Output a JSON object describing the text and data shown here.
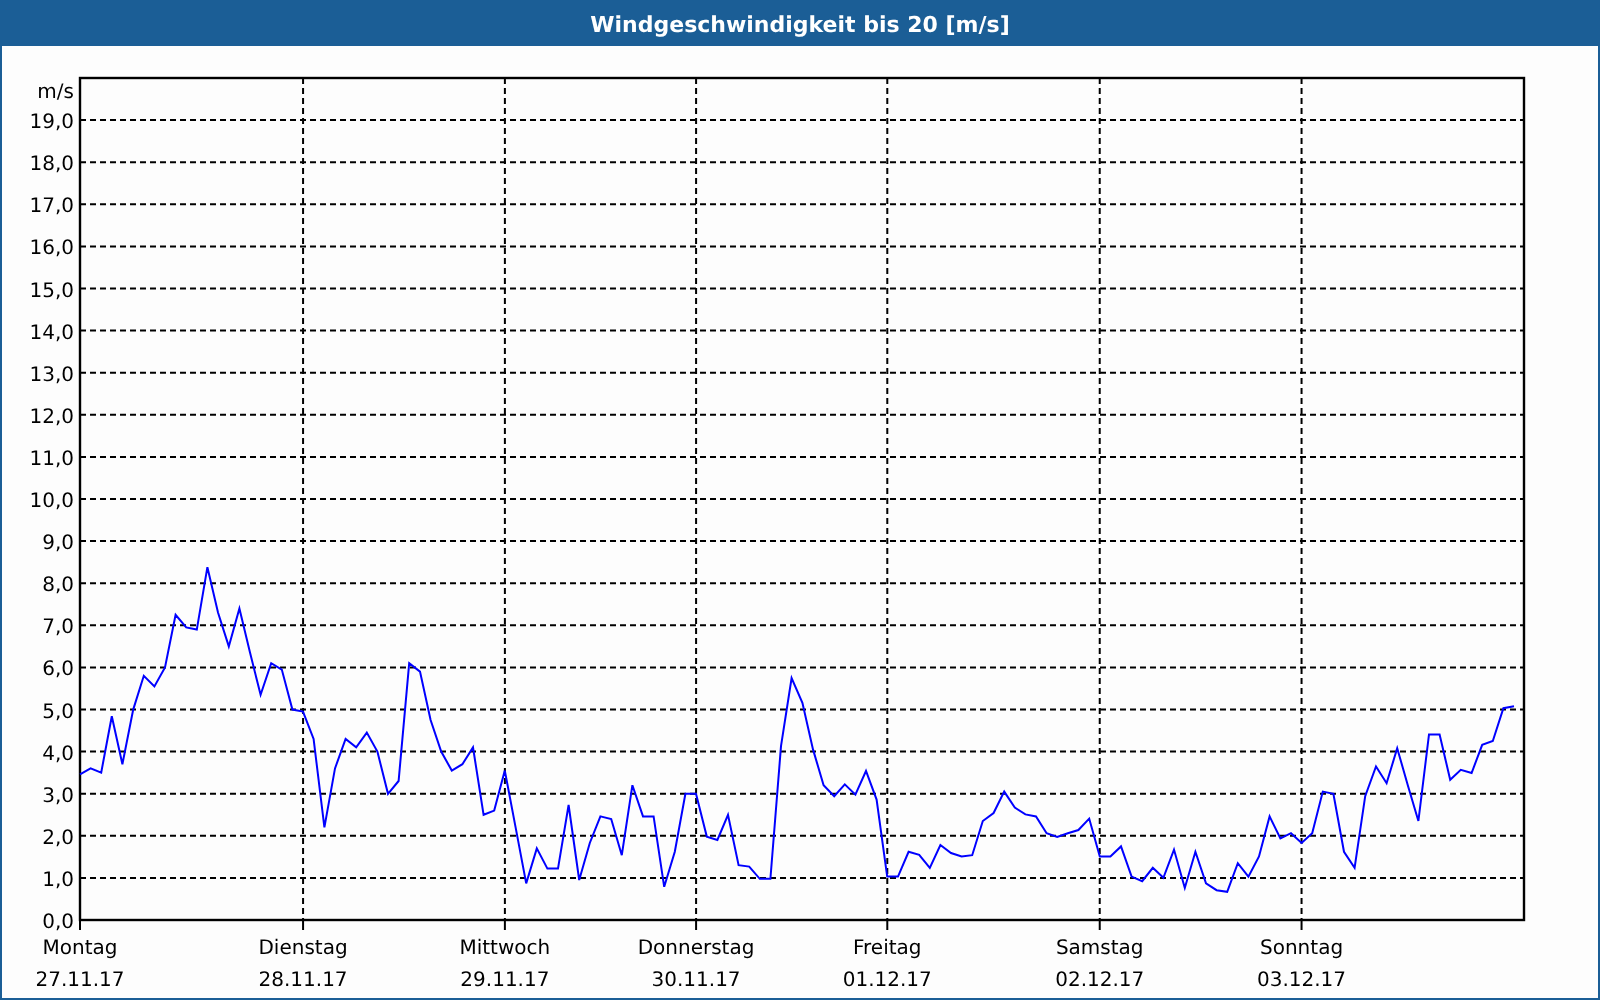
{
  "window": {
    "title": "Windgeschwindigkeit bis 20 [m/s]"
  },
  "chart_data": {
    "type": "line",
    "ylabel": "m/s",
    "grid": true,
    "ylim": [
      0,
      20
    ],
    "yticks": [
      {
        "value": 0,
        "label": "0,0"
      },
      {
        "value": 1,
        "label": "1,0"
      },
      {
        "value": 2,
        "label": "2,0"
      },
      {
        "value": 3,
        "label": "3,0"
      },
      {
        "value": 4,
        "label": "4,0"
      },
      {
        "value": 5,
        "label": "5,0"
      },
      {
        "value": 6,
        "label": "6,0"
      },
      {
        "value": 7,
        "label": "7,0"
      },
      {
        "value": 8,
        "label": "8,0"
      },
      {
        "value": 9,
        "label": "9,0"
      },
      {
        "value": 10,
        "label": "10,0"
      },
      {
        "value": 11,
        "label": "11,0"
      },
      {
        "value": 12,
        "label": "12,0"
      },
      {
        "value": 13,
        "label": "13,0"
      },
      {
        "value": 14,
        "label": "14,0"
      },
      {
        "value": 15,
        "label": "15,0"
      },
      {
        "value": 16,
        "label": "16,0"
      },
      {
        "value": 17,
        "label": "17,0"
      },
      {
        "value": 18,
        "label": "18,0"
      },
      {
        "value": 19,
        "label": "19,0"
      }
    ],
    "categories": [
      "Montag\n27.11.17",
      null,
      null,
      null,
      null,
      null,
      null,
      null,
      null,
      null,
      null,
      null,
      null,
      null,
      null,
      null,
      null,
      null,
      null,
      null,
      null,
      "Dienstag\n28.11.17",
      null,
      null,
      null,
      null,
      null,
      null,
      null,
      null,
      null,
      null,
      null,
      null,
      null,
      null,
      null,
      null,
      null,
      null,
      "Mittwoch\n29.11.17",
      null,
      null,
      null,
      null,
      null,
      null,
      null,
      null,
      null,
      null,
      null,
      null,
      null,
      null,
      null,
      null,
      null,
      "Donnerstag\n30.11.17",
      null,
      null,
      null,
      null,
      null,
      null,
      null,
      null,
      null,
      null,
      null,
      null,
      null,
      null,
      null,
      null,
      null,
      "Freitag\n01.12.17",
      null,
      null,
      null,
      null,
      null,
      null,
      null,
      null,
      null,
      null,
      null,
      null,
      null,
      null,
      null,
      null,
      null,
      null,
      null,
      "Samstag\n02.12.17",
      null,
      null,
      null,
      null,
      null,
      null,
      null,
      null,
      null,
      null,
      null,
      null,
      null,
      null,
      null,
      null,
      null,
      null,
      "Sonntag\n03.12.17",
      null,
      null,
      null,
      null,
      null,
      null,
      null,
      null,
      null,
      null,
      null,
      null,
      null,
      null,
      null,
      null,
      null,
      null,
      null,
      null
    ],
    "series": [
      {
        "color": "#0000ff",
        "values": [
          3.46,
          3.6,
          3.5,
          4.84,
          3.7,
          5.0,
          5.8,
          5.55,
          6.0,
          7.25,
          6.95,
          6.9,
          8.38,
          7.3,
          6.5,
          7.4,
          6.35,
          5.35,
          6.1,
          5.95,
          5.0,
          4.95,
          4.3,
          2.2,
          3.6,
          4.3,
          4.1,
          4.45,
          4.0,
          3.0,
          3.3,
          6.1,
          5.9,
          4.75,
          4.0,
          3.55,
          3.7,
          4.1,
          2.5,
          2.6,
          3.55,
          2.2,
          0.87,
          1.7,
          1.22,
          1.22,
          2.73,
          0.95,
          1.83,
          2.46,
          2.4,
          1.54,
          3.2,
          2.46,
          2.46,
          0.79,
          1.62,
          3.0,
          3.0,
          1.98,
          1.9,
          2.5,
          1.3,
          1.27,
          0.98,
          0.98,
          4.13,
          5.75,
          5.16,
          4.05,
          3.2,
          2.94,
          3.22,
          2.98,
          3.54,
          2.86,
          1.03,
          1.03,
          1.62,
          1.55,
          1.24,
          1.78,
          1.59,
          1.51,
          1.54,
          2.35,
          2.54,
          3.05,
          2.67,
          2.51,
          2.46,
          2.06,
          1.97,
          2.06,
          2.14,
          2.41,
          1.51,
          1.51,
          1.75,
          1.03,
          0.92,
          1.24,
          1.0,
          1.67,
          0.76,
          1.62,
          0.87,
          0.71,
          0.67,
          1.35,
          1.03,
          1.51,
          2.46,
          1.94,
          2.06,
          1.83,
          2.06,
          3.05,
          3.0,
          1.62,
          1.24,
          2.94,
          3.65,
          3.25,
          4.08,
          3.2,
          2.35,
          4.41,
          4.41,
          3.33,
          3.57,
          3.49,
          4.16,
          4.25,
          5.03,
          5.08
        ]
      }
    ]
  }
}
